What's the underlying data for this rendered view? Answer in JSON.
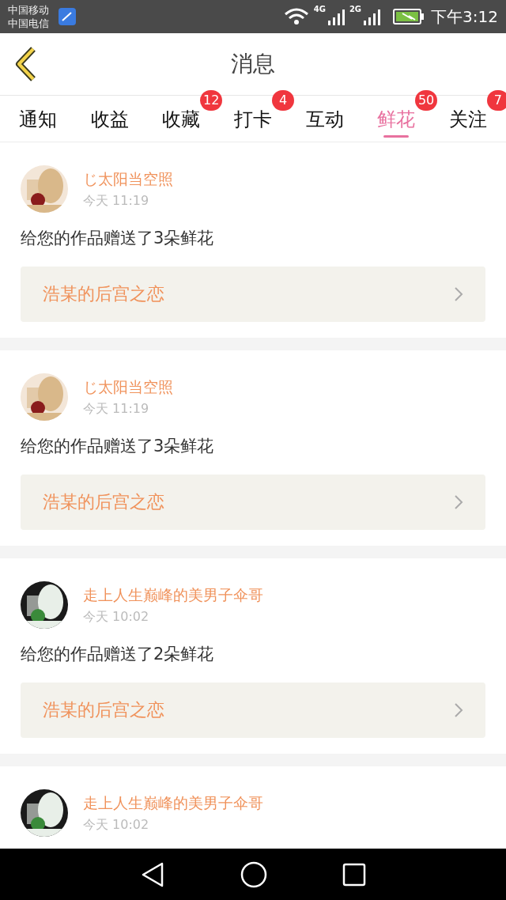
{
  "status_bar": {
    "carriers": [
      "中国移动",
      "中国电信"
    ],
    "network_1": "4G",
    "network_2": "2G",
    "time": "下午3:12"
  },
  "header": {
    "title": "消息"
  },
  "tabs": [
    {
      "label": "通知",
      "selected": false
    },
    {
      "label": "收益",
      "selected": false
    },
    {
      "label": "收藏",
      "selected": false,
      "badge": "12"
    },
    {
      "label": "打卡",
      "selected": false,
      "badge": "4"
    },
    {
      "label": "互动",
      "selected": false
    },
    {
      "label": "鲜花",
      "selected": true,
      "badge": "50"
    },
    {
      "label": "关注",
      "selected": false,
      "badge": "7"
    }
  ],
  "messages": [
    {
      "user": "じ太阳当空照",
      "time": "今天 11:19",
      "text": "给您的作品赠送了3朵鲜花",
      "work": "浩某的后宫之恋"
    },
    {
      "user": "じ太阳当空照",
      "time": "今天 11:19",
      "text": "给您的作品赠送了3朵鲜花",
      "work": "浩某的后宫之恋"
    },
    {
      "user": "走上人生巅峰的美男子伞哥",
      "time": "今天 10:02",
      "text": "给您的作品赠送了2朵鲜花",
      "work": "浩某的后宫之恋"
    },
    {
      "user": "走上人生巅峰的美男子伞哥",
      "time": "今天 10:02"
    }
  ]
}
